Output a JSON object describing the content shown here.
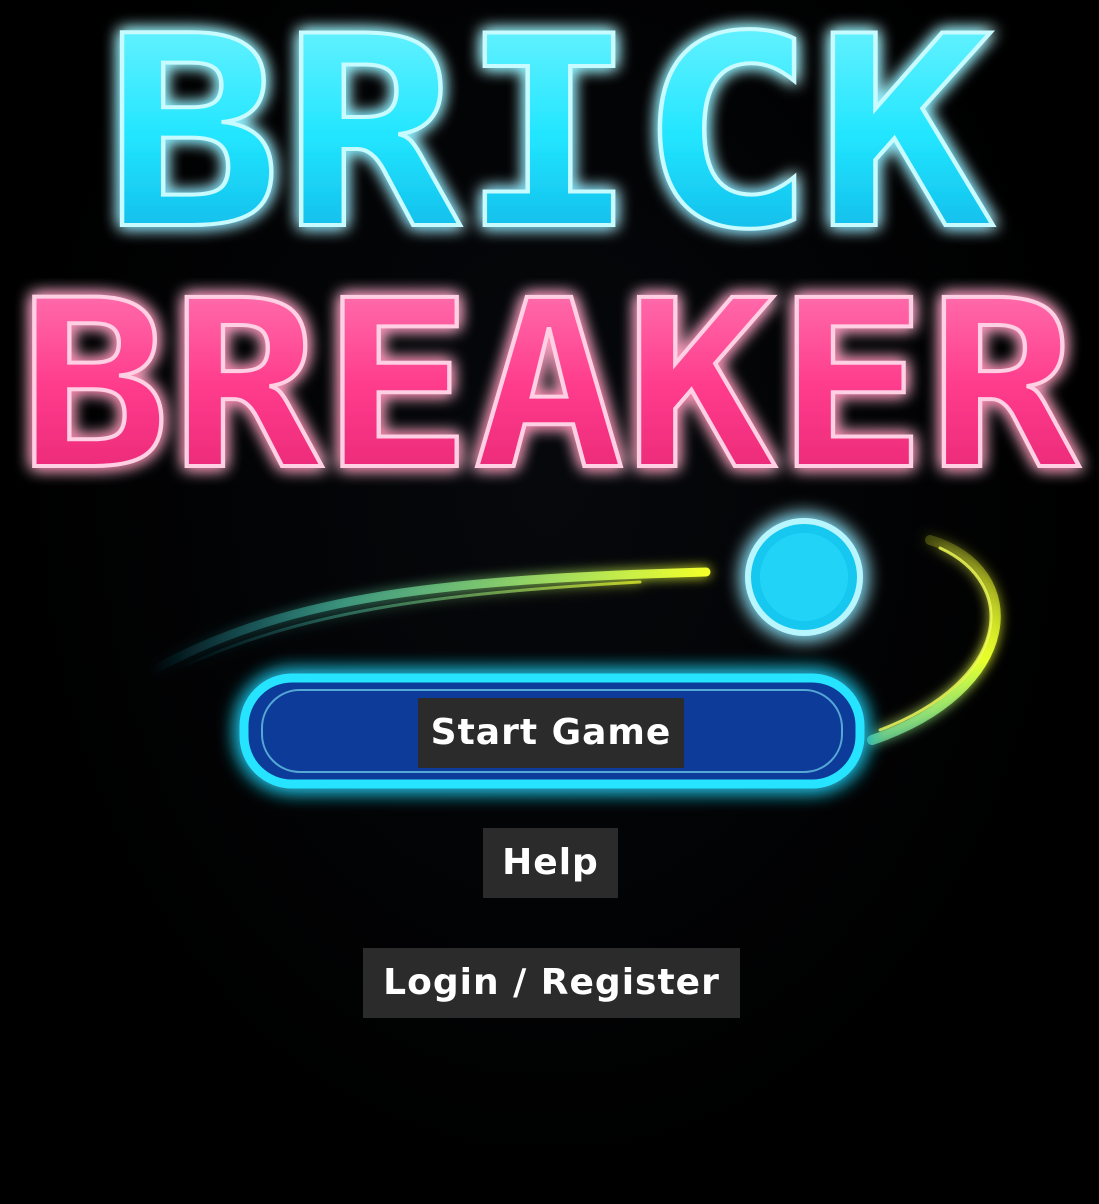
{
  "logo": {
    "line_1": "BRICK",
    "line_2": "BREAKER",
    "line_1_color": "#22e6ff",
    "line_2_color": "#ff3c8c"
  },
  "decorations": {
    "ball_color": "#2fdcff",
    "trail_color": "#e8ff2a",
    "paddle_fill": "#0a3a99",
    "paddle_border": "#26e4ff"
  },
  "menu": {
    "start_game": "Start Game",
    "help": "Help",
    "login_register": "Login / Register"
  },
  "icons": {
    "ball": "ball-icon",
    "paddle": "paddle-icon",
    "trail": "trail-icon"
  }
}
